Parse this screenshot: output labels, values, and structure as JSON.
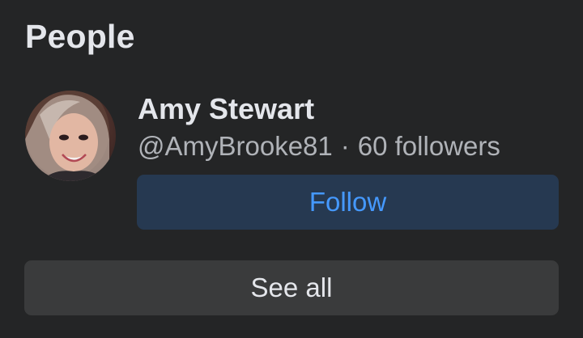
{
  "section": {
    "title": "People"
  },
  "person": {
    "name": "Amy Stewart",
    "handle": "@AmyBrooke81",
    "separator": "·",
    "followers": "60 followers",
    "avatar_icon": "profile-photo"
  },
  "actions": {
    "follow_label": "Follow",
    "see_all_label": "See all"
  },
  "colors": {
    "background": "#242526",
    "follow_bg": "#263951",
    "follow_text": "#4599ff",
    "see_all_bg": "#3a3b3c",
    "primary_text": "#e4e6eb",
    "secondary_text": "#b0b3b8"
  }
}
